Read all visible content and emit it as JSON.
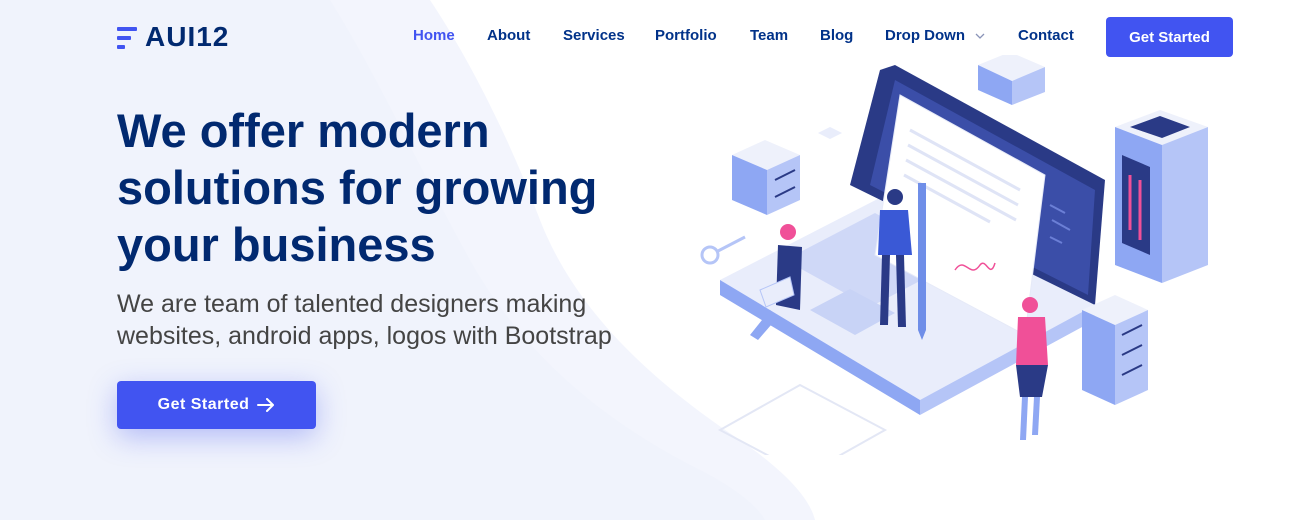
{
  "brand": {
    "name": "AUI12"
  },
  "nav": {
    "items": [
      {
        "label": "Home",
        "active": true
      },
      {
        "label": "About"
      },
      {
        "label": "Services"
      },
      {
        "label": "Portfolio"
      },
      {
        "label": "Team"
      },
      {
        "label": "Blog"
      },
      {
        "label": "Drop Down",
        "icon": "chevron-down-icon"
      },
      {
        "label": "Contact"
      }
    ],
    "cta_label": "Get Started"
  },
  "hero": {
    "title": "We offer modern solutions for growing your business",
    "subtitle": "We are team of talented designers making websites, android apps, logos with Bootstrap",
    "cta_label": "Get Started",
    "cta_icon": "arrow-right-icon"
  },
  "colors": {
    "accent": "#4154f1",
    "heading": "#012970",
    "nav_text": "#013289",
    "body_text": "#444444",
    "hero_bg": "#f3f5fd"
  }
}
